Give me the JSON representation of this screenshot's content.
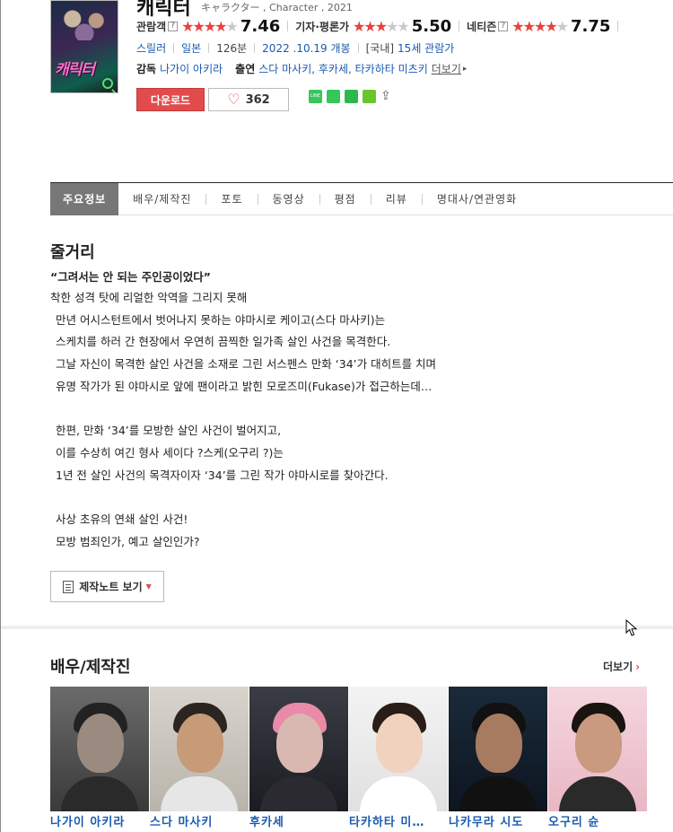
{
  "movie": {
    "title": "캐릭터",
    "subtitle": "キャラクター , Character , 2021",
    "poster_title": "캐릭터"
  },
  "ratings": [
    {
      "label": "관람객",
      "help": "?",
      "stars_filled": 3.73,
      "score": "7.46"
    },
    {
      "label": "기자·평론가",
      "help": "",
      "stars_filled": 2.75,
      "score": "5.50"
    },
    {
      "label": "네티즌",
      "help": "?",
      "stars_filled": 3.88,
      "score": "7.75"
    }
  ],
  "meta": {
    "genre": "스릴러",
    "country": "일본",
    "runtime": "126분",
    "release": "2022 .10.19 개봉",
    "rating_prefix": "[국내]",
    "rating": "15세 관람가"
  },
  "credits": {
    "director_label": "감독",
    "director": "나가이 아키라",
    "cast_label": "출연",
    "cast": "스다 마사키, 후카세, 타카하타 미츠키",
    "more": "더보기"
  },
  "actions": {
    "download": "다운로드",
    "like_count": "362",
    "line_text": "LINE"
  },
  "tabs": [
    "주요정보",
    "배우/제작진",
    "포토",
    "동영상",
    "평점",
    "리뷰",
    "명대사/연관영화"
  ],
  "synopsis": {
    "section_title": "줄거리",
    "headline": "“그려서는 안 되는 주인공이었다”",
    "lines": [
      "착한 성격 탓에 리얼한 악역을 그리지 못해",
      "만년 어시스턴트에서 벗어나지 못하는 야마시로 케이고(스다 마사키)는",
      "스케치를 하러 간 현장에서 우연히 끔찍한 일가족 살인 사건을 목격한다.",
      "그날 자신이 목격한 살인 사건을 소재로 그린 서스펜스 만화 ‘34’가 대히트를 치며",
      "유명 작가가 된 야마시로 앞에 팬이라고 밝힌 모로즈미(Fukase)가 접근하는데…",
      "",
      "한편, 만화 ‘34’를 모방한 살인 사건이 벌어지고,",
      "이를 수상히 여긴 형사 세이다 ?스케(오구리 ?)는",
      "1년 전 살인 사건의 목격자이자 ‘34’를 그린 작가 야마시로를 찾아간다.",
      "",
      "사상 초유의 연쇄 살인 사건!",
      "모방 범죄인가, 예고 살인인가?"
    ],
    "notes_button": "제작노트 보기"
  },
  "cast_section": {
    "title": "배우/제작진",
    "more": "더보기",
    "people": [
      "나가이 아키라",
      "스다 마사키",
      "후카세",
      "타카하타 미…",
      "나카무라 시도",
      "오구리 슌"
    ]
  },
  "colors": {
    "accent": "#e24b4b",
    "link": "#1a5bb0",
    "tab_active": "#777777"
  }
}
